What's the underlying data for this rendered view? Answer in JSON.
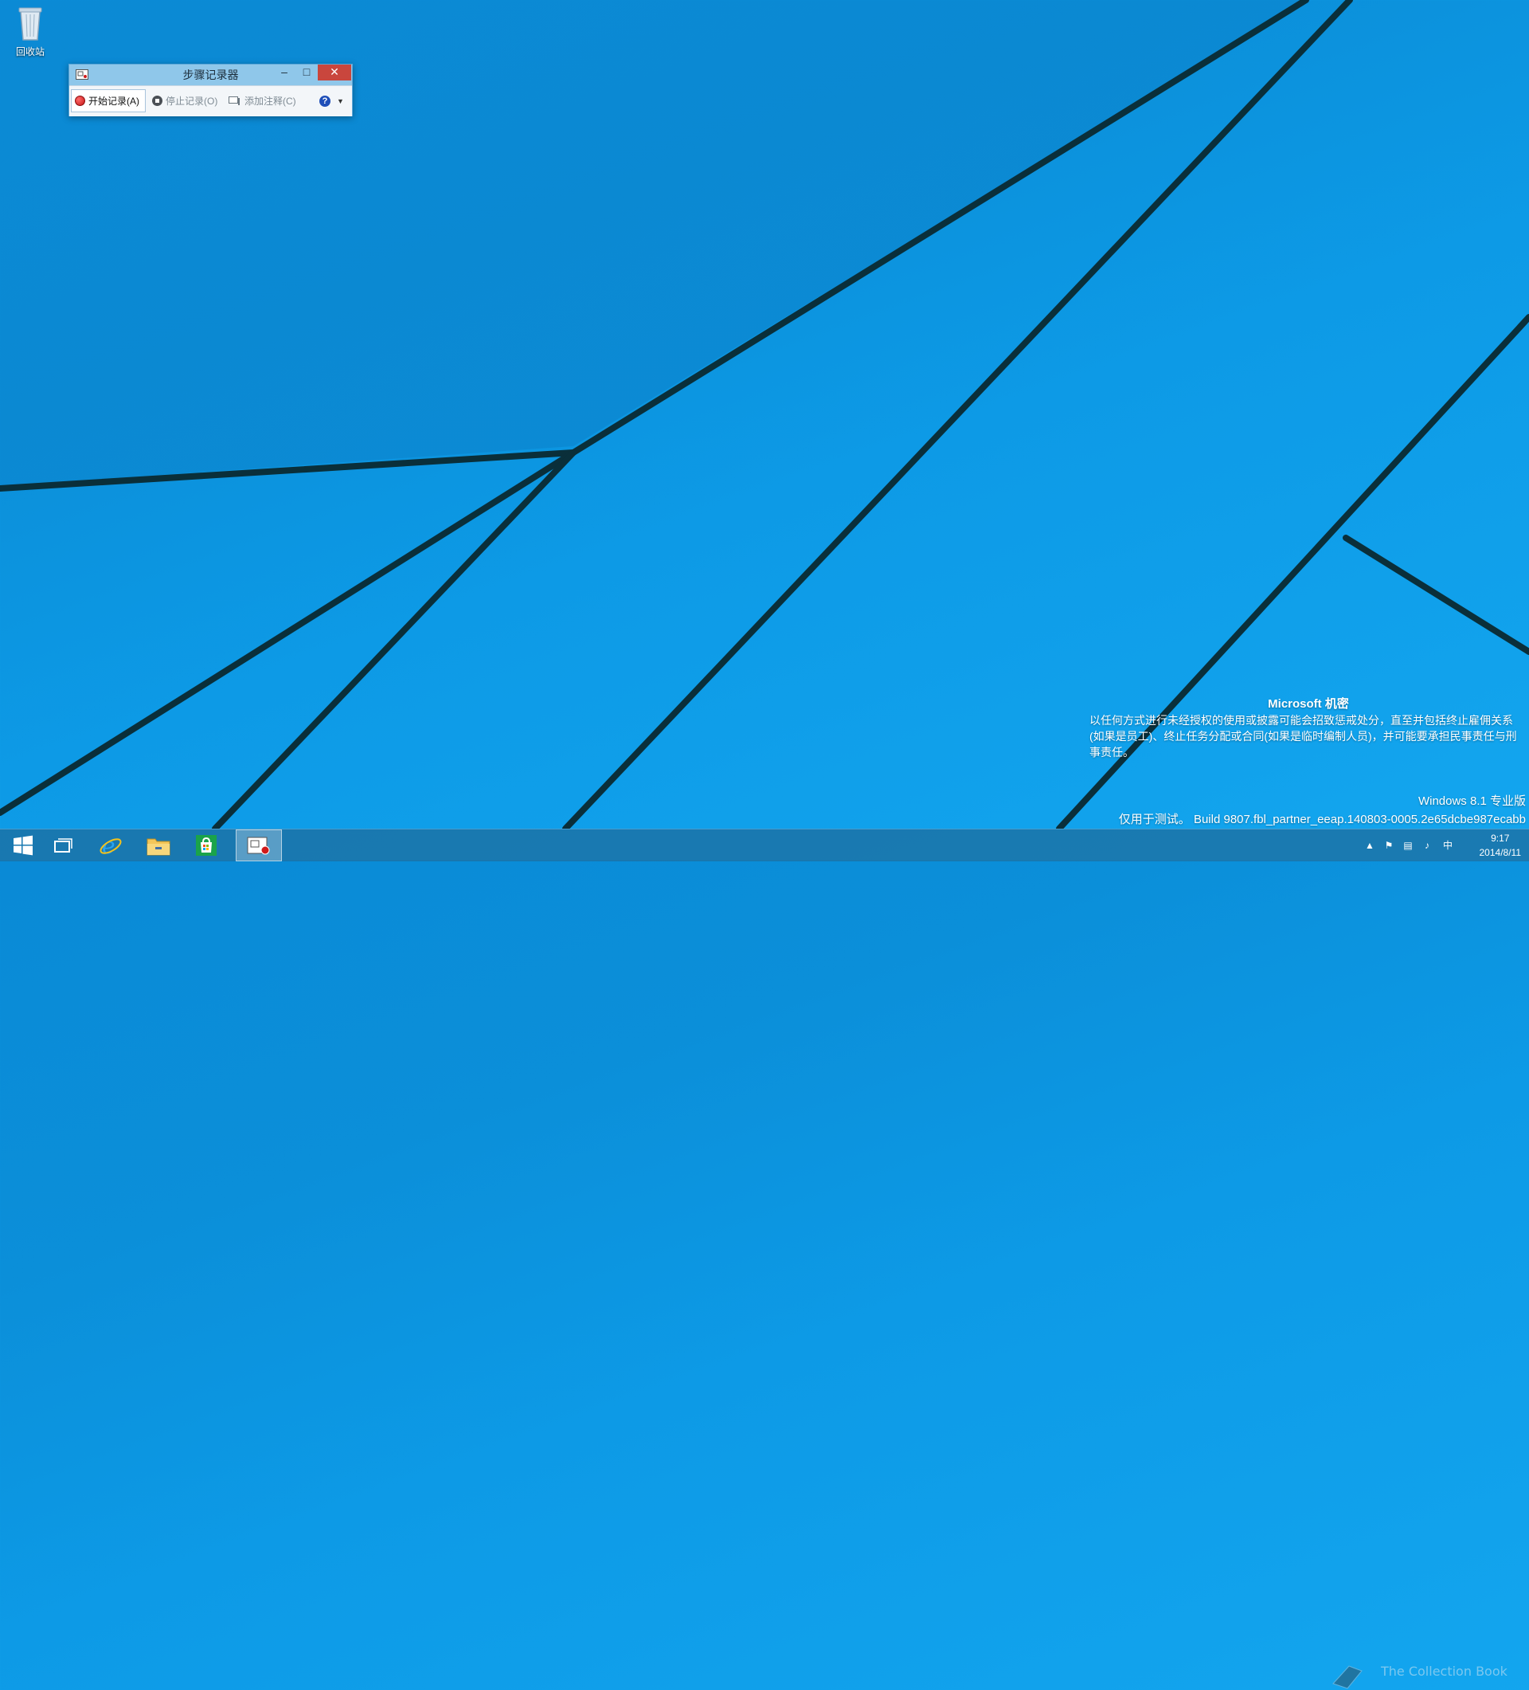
{
  "desktop": {
    "recycle_bin_label": "回收站"
  },
  "psr": {
    "title": "步骤记录器",
    "buttons": {
      "minimize": "–",
      "maximize": "□",
      "close": "✕"
    },
    "toolbar": {
      "start": "开始记录(A)",
      "stop": "停止记录(O)",
      "comment": "添加注释(C)",
      "help": "?",
      "dropdown": "▼"
    }
  },
  "watermark": {
    "heading": "Microsoft 机密",
    "body": "以任何方式进行未经授权的使用或披露可能会招致惩戒处分，直至并包括终止雇佣关系(如果是员工)、终止任务分配或合同(如果是临时编制人员)，并可能要承担民事责任与刑事责任。",
    "edition": "Windows 8.1 专业版",
    "build": "仅用于测试。 Build 9807.fbl_partner_eeap.140803-0005.2e65dcbe987ecabb"
  },
  "taskbar": {
    "items": [
      {
        "icon": "windows-start-icon"
      },
      {
        "icon": "task-view-icon"
      },
      {
        "icon": "internet-explorer-icon"
      },
      {
        "icon": "file-explorer-icon"
      },
      {
        "icon": "store-icon"
      },
      {
        "icon": "steps-recorder-icon"
      }
    ],
    "tray": {
      "ime": "中",
      "time": "9:17",
      "date": "2014/8/11",
      "overlay_text": "The Collection Book"
    }
  },
  "colors": {
    "close_button": "#c9463d",
    "titlebar": "#8fc7ea",
    "record_red": "#d01a1a"
  }
}
